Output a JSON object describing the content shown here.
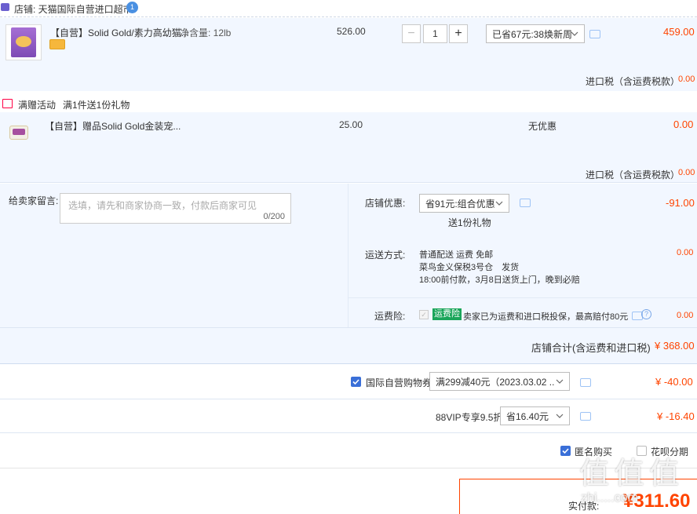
{
  "shop": {
    "label": "店铺: 天猫国际自营进口超市",
    "badge": "1"
  },
  "item1": {
    "title": "【自营】Solid Gold/素力高幼猫...",
    "spec": "净含量: 12lb",
    "price": "526.00",
    "qty": "1",
    "promo": "已省67元:38焕新周",
    "total": "459.00",
    "tax_label": "进口税（含运费税款）",
    "tax_value": "0.00"
  },
  "gift_section": {
    "label": "满赠活动",
    "desc": "满1件送1份礼物",
    "item_title": "【自营】赠品Solid Gold金装宠...",
    "price": "25.00",
    "promo": "无优惠",
    "total": "0.00",
    "tax_label": "进口税（含运费税款）",
    "tax_value": "0.00"
  },
  "message": {
    "label": "给卖家留言:",
    "placeholder": "选填，请先和商家协商一致，付款后商家可见",
    "count": "0/200"
  },
  "shop_discount": {
    "label": "店铺优惠:",
    "select": "省91元:组合优惠",
    "sub": "送1份礼物",
    "value": "-91.00"
  },
  "shipping": {
    "label": "运送方式:",
    "line1": "普通配送 运费 免邮",
    "line2": "菜鸟金义保税3号仓　发货",
    "line3": "18:00前付款，3月8日送货上门，晚到必赔",
    "value": "0.00"
  },
  "insurance": {
    "label": "运费险:",
    "tag": "运费险",
    "desc": "卖家已为运费和进口税投保，最高赔付80元",
    "value": "0.00"
  },
  "shop_total": {
    "label": "店铺合计(含运费和进口税)",
    "value": "¥ 368.00"
  },
  "coupon": {
    "label": "国际自营购物券",
    "select": "满299减40元（2023.03.02 ...",
    "value": "¥ -40.00"
  },
  "vip": {
    "label": "88VIP专享9.5折",
    "select": "省16.40元",
    "value": "¥ -16.40"
  },
  "anonymous": {
    "label": "匿名购买"
  },
  "huabei": {
    "label": "花呗分期"
  },
  "pay": {
    "label": "实付款:",
    "value": "¥311.60"
  },
  "watermark": {
    "text": "值 值 值",
    "site": "zhi.....com"
  },
  "colors": {
    "accent_red": "#ff4400",
    "blue_check": "#3a6fd8",
    "light_blue_bg": "#f2f7ff",
    "tag_green": "#1aa55a"
  }
}
